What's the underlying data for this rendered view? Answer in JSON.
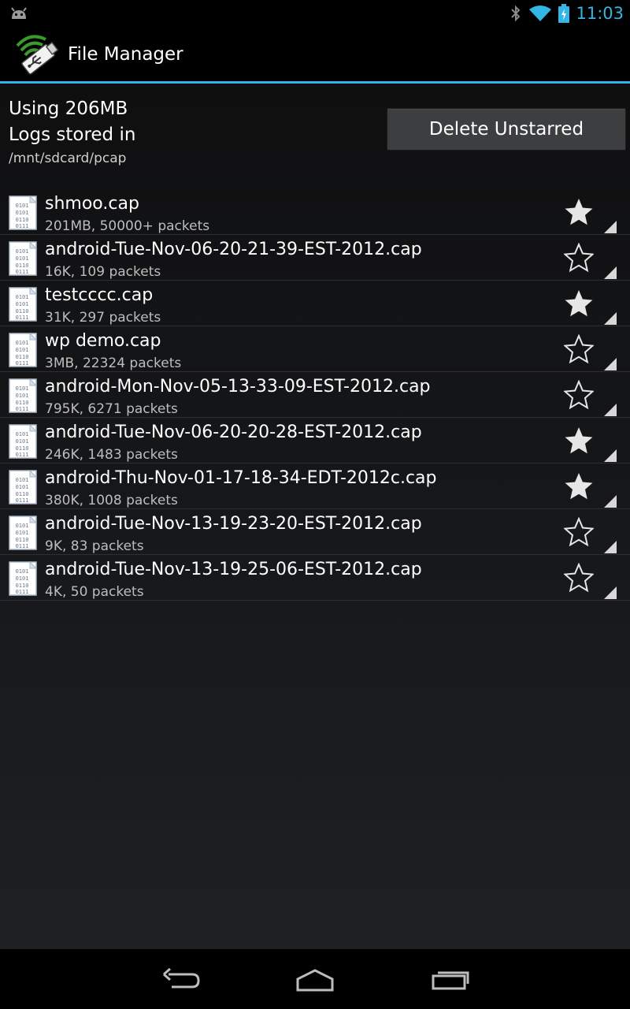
{
  "status_bar": {
    "time": "11:03",
    "icons": [
      "android-debug-icon",
      "bluetooth-icon",
      "wifi-icon",
      "battery-charging-icon"
    ],
    "accent_color": "#33b5e5"
  },
  "action_bar": {
    "title": "File Manager",
    "icon": "usb-wifi-app-icon"
  },
  "summary": {
    "usage": "Using 206MB",
    "logs_label": "Logs stored in",
    "logs_path": "/mnt/sdcard/pcap",
    "delete_button": "Delete Unstarred"
  },
  "files": [
    {
      "name": "shmoo.cap",
      "meta": "201MB, 50000+ packets",
      "starred": true
    },
    {
      "name": "android-Tue-Nov-06-20-21-39-EST-2012.cap",
      "meta": "16K, 109 packets",
      "starred": false
    },
    {
      "name": "testcccc.cap",
      "meta": "31K, 297 packets",
      "starred": true
    },
    {
      "name": "wp demo.cap",
      "meta": "3MB, 22324 packets",
      "starred": false
    },
    {
      "name": "android-Mon-Nov-05-13-33-09-EST-2012.cap",
      "meta": "795K, 6271 packets",
      "starred": false
    },
    {
      "name": "android-Tue-Nov-06-20-20-28-EST-2012.cap",
      "meta": "246K, 1483 packets",
      "starred": true
    },
    {
      "name": "android-Thu-Nov-01-17-18-34-EDT-2012c.cap",
      "meta": "380K, 1008 packets",
      "starred": true
    },
    {
      "name": "android-Tue-Nov-13-19-23-20-EST-2012.cap",
      "meta": "9K, 83 packets",
      "starred": false
    },
    {
      "name": "android-Tue-Nov-13-19-25-06-EST-2012.cap",
      "meta": "4K, 50 packets",
      "starred": false
    }
  ],
  "nav_bar": {
    "icons": [
      "back-icon",
      "home-icon",
      "recent-apps-icon"
    ]
  }
}
